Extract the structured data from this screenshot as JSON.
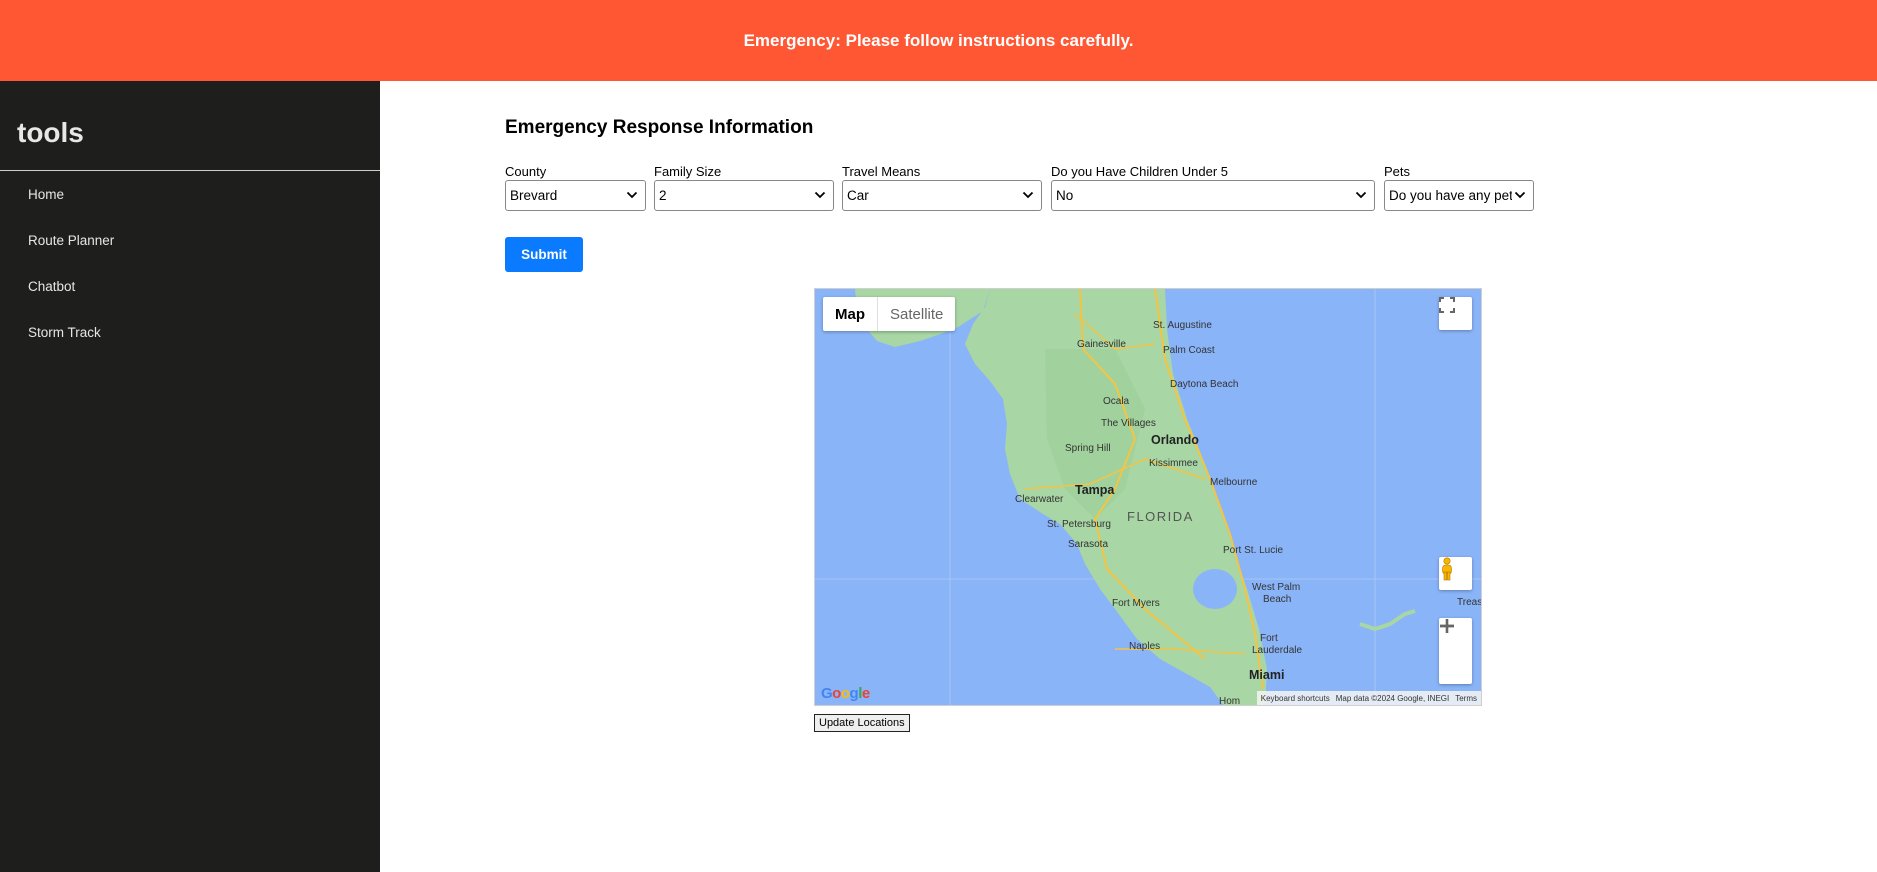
{
  "banner": {
    "text": "Emergency: Please follow instructions carefully."
  },
  "sidebar": {
    "title": "tools",
    "items": [
      {
        "label": "Home"
      },
      {
        "label": "Route Planner"
      },
      {
        "label": "Chatbot"
      },
      {
        "label": "Storm Track"
      }
    ]
  },
  "form": {
    "heading": "Emergency Response Information",
    "fields": [
      {
        "label": "County",
        "value": "Brevard"
      },
      {
        "label": "Family Size",
        "value": "2"
      },
      {
        "label": "Travel Means",
        "value": "Car"
      },
      {
        "label": "Do you Have Children Under 5",
        "value": "No"
      },
      {
        "label": "Pets",
        "value": "Do you have any pets?"
      }
    ],
    "submit_label": "Submit"
  },
  "map": {
    "type_controls": {
      "map": "Map",
      "satellite": "Satellite"
    },
    "logo": "Google",
    "attribution": {
      "shortcuts": "Keyboard shortcuts",
      "data": "Map data ©2024 Google, INEGI",
      "terms": "Terms"
    },
    "labels": {
      "st_augustine": "St. Augustine",
      "gainesville": "Gainesville",
      "palm_coast": "Palm Coast",
      "daytona": "Daytona Beach",
      "ocala": "Ocala",
      "villages": "The Villages",
      "orlando": "Orlando",
      "spring_hill": "Spring Hill",
      "kissimmee": "Kissimmee",
      "melbourne": "Melbourne",
      "tampa": "Tampa",
      "clearwater": "Clearwater",
      "st_pete": "St. Petersburg",
      "florida": "FLORIDA",
      "sarasota": "Sarasota",
      "port_st_lucie": "Port St. Lucie",
      "west_palm": "West Palm",
      "west_palm2": "Beach",
      "fort_myers": "Fort Myers",
      "fort_laud": "Fort",
      "fort_laud2": "Lauderdale",
      "naples": "Naples",
      "miami": "Miami",
      "treas": "Treas",
      "homestead": "Hom"
    }
  },
  "update_button": {
    "label": "Update Locations"
  }
}
